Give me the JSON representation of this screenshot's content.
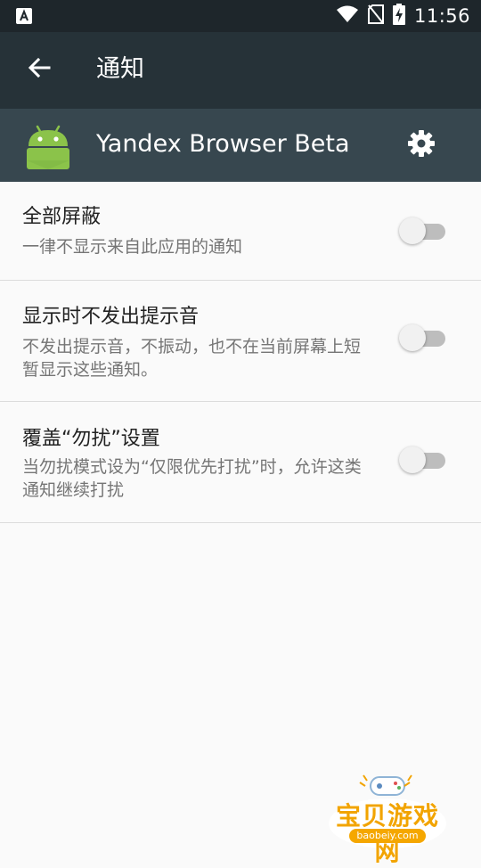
{
  "status_bar": {
    "time": "11:56",
    "icons": [
      "a-notification-icon",
      "wifi-icon",
      "no-sim-icon",
      "battery-charging-icon"
    ]
  },
  "toolbar": {
    "back_icon": "arrow-back-icon",
    "title": "通知"
  },
  "app_header": {
    "app_icon": "android-icon",
    "app_name": "Yandex Browser Beta",
    "settings_icon": "gear-icon"
  },
  "settings": [
    {
      "title": "全部屏蔽",
      "subtitle": "一律不显示来自此应用的通知",
      "enabled": false
    },
    {
      "title": "显示时不发出提示音",
      "subtitle": "不发出提示音，不振动，也不在当前屏幕上短暂显示这些通知。",
      "enabled": false
    },
    {
      "title": "覆盖“勿扰”设置",
      "subtitle": "当勿扰模式设为“仅限优先打扰”时，允许这类通知继续打扰",
      "enabled": false
    }
  ],
  "watermark": {
    "text": "宝贝游戏网",
    "domain": "baobeiy.com"
  },
  "colors": {
    "status_bar": "#1e262b",
    "toolbar": "#263238",
    "app_header": "#37474f",
    "android_green": "#8bc34a",
    "switch_off_track": "#bdbdbd",
    "switch_off_thumb": "#f1f1f1"
  }
}
